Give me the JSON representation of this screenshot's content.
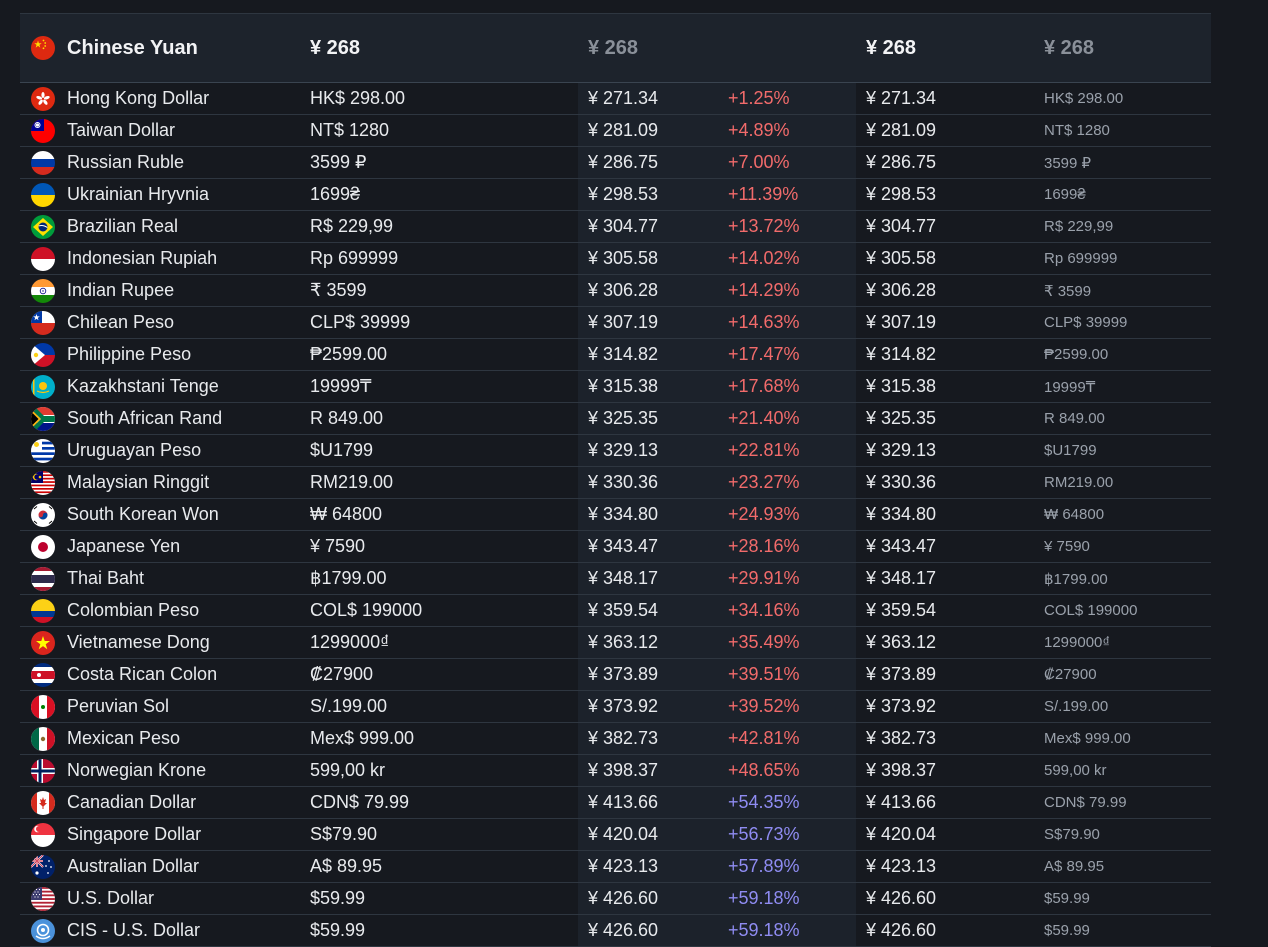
{
  "header": {
    "flag": "cn-flag-icon",
    "name": "Chinese Yuan",
    "local": "¥ 268",
    "converted": "¥ 268",
    "converted2": "¥ 268",
    "local2": "¥ 268"
  },
  "colors": {
    "increase": "#f26b6b",
    "large_increase": "#8f8cf2",
    "background": "#16191f",
    "header_background": "#1d232c"
  },
  "rows": [
    {
      "flag": "hk",
      "name": "Hong Kong Dollar",
      "local": "HK$ 298.00",
      "converted": "¥ 271.34",
      "pct": "+1.25%",
      "pct_color": "up"
    },
    {
      "flag": "tw",
      "name": "Taiwan Dollar",
      "local": "NT$ 1280",
      "converted": "¥ 281.09",
      "pct": "+4.89%",
      "pct_color": "up"
    },
    {
      "flag": "ru",
      "name": "Russian Ruble",
      "local": "3599 ₽",
      "converted": "¥ 286.75",
      "pct": "+7.00%",
      "pct_color": "up"
    },
    {
      "flag": "ua",
      "name": "Ukrainian Hryvnia",
      "local": "1699₴",
      "converted": "¥ 298.53",
      "pct": "+11.39%",
      "pct_color": "up"
    },
    {
      "flag": "br",
      "name": "Brazilian Real",
      "local": "R$ 229,99",
      "converted": "¥ 304.77",
      "pct": "+13.72%",
      "pct_color": "up"
    },
    {
      "flag": "id",
      "name": "Indonesian Rupiah",
      "local": "Rp 699999",
      "converted": "¥ 305.58",
      "pct": "+14.02%",
      "pct_color": "up"
    },
    {
      "flag": "in",
      "name": "Indian Rupee",
      "local": "₹ 3599",
      "converted": "¥ 306.28",
      "pct": "+14.29%",
      "pct_color": "up"
    },
    {
      "flag": "cl",
      "name": "Chilean Peso",
      "local": "CLP$ 39999",
      "converted": "¥ 307.19",
      "pct": "+14.63%",
      "pct_color": "up"
    },
    {
      "flag": "ph",
      "name": "Philippine Peso",
      "local": "₱2599.00",
      "converted": "¥ 314.82",
      "pct": "+17.47%",
      "pct_color": "up"
    },
    {
      "flag": "kz",
      "name": "Kazakhstani Tenge",
      "local": "19999₸",
      "converted": "¥ 315.38",
      "pct": "+17.68%",
      "pct_color": "up"
    },
    {
      "flag": "za",
      "name": "South African Rand",
      "local": "R 849.00",
      "converted": "¥ 325.35",
      "pct": "+21.40%",
      "pct_color": "up"
    },
    {
      "flag": "uy",
      "name": "Uruguayan Peso",
      "local": "$U1799",
      "converted": "¥ 329.13",
      "pct": "+22.81%",
      "pct_color": "up"
    },
    {
      "flag": "my",
      "name": "Malaysian Ringgit",
      "local": "RM219.00",
      "converted": "¥ 330.36",
      "pct": "+23.27%",
      "pct_color": "up"
    },
    {
      "flag": "kr",
      "name": "South Korean Won",
      "local": "₩ 64800",
      "converted": "¥ 334.80",
      "pct": "+24.93%",
      "pct_color": "up"
    },
    {
      "flag": "jp",
      "name": "Japanese Yen",
      "local": "¥ 7590",
      "converted": "¥ 343.47",
      "pct": "+28.16%",
      "pct_color": "up"
    },
    {
      "flag": "th",
      "name": "Thai Baht",
      "local": "฿1799.00",
      "converted": "¥ 348.17",
      "pct": "+29.91%",
      "pct_color": "up"
    },
    {
      "flag": "co",
      "name": "Colombian Peso",
      "local": "COL$ 199000",
      "converted": "¥ 359.54",
      "pct": "+34.16%",
      "pct_color": "up"
    },
    {
      "flag": "vn",
      "name": "Vietnamese Dong",
      "local": "1299000₫",
      "converted": "¥ 363.12",
      "pct": "+35.49%",
      "pct_color": "up"
    },
    {
      "flag": "cr",
      "name": "Costa Rican Colon",
      "local": "₡27900",
      "converted": "¥ 373.89",
      "pct": "+39.51%",
      "pct_color": "up"
    },
    {
      "flag": "pe",
      "name": "Peruvian Sol",
      "local": "S/.199.00",
      "converted": "¥ 373.92",
      "pct": "+39.52%",
      "pct_color": "up"
    },
    {
      "flag": "mx",
      "name": "Mexican Peso",
      "local": "Mex$ 999.00",
      "converted": "¥ 382.73",
      "pct": "+42.81%",
      "pct_color": "up"
    },
    {
      "flag": "no",
      "name": "Norwegian Krone",
      "local": "599,00 kr",
      "converted": "¥ 398.37",
      "pct": "+48.65%",
      "pct_color": "up"
    },
    {
      "flag": "ca",
      "name": "Canadian Dollar",
      "local": "CDN$ 79.99",
      "converted": "¥ 413.66",
      "pct": "+54.35%",
      "pct_color": "blue"
    },
    {
      "flag": "sg",
      "name": "Singapore Dollar",
      "local": "S$79.90",
      "converted": "¥ 420.04",
      "pct": "+56.73%",
      "pct_color": "blue"
    },
    {
      "flag": "au",
      "name": "Australian Dollar",
      "local": "A$ 89.95",
      "converted": "¥ 423.13",
      "pct": "+57.89%",
      "pct_color": "blue"
    },
    {
      "flag": "us",
      "name": "U.S. Dollar",
      "local": "$59.99",
      "converted": "¥ 426.60",
      "pct": "+59.18%",
      "pct_color": "blue"
    },
    {
      "flag": "un",
      "name": "CIS - U.S. Dollar",
      "local": "$59.99",
      "converted": "¥ 426.60",
      "pct": "+59.18%",
      "pct_color": "blue"
    }
  ]
}
